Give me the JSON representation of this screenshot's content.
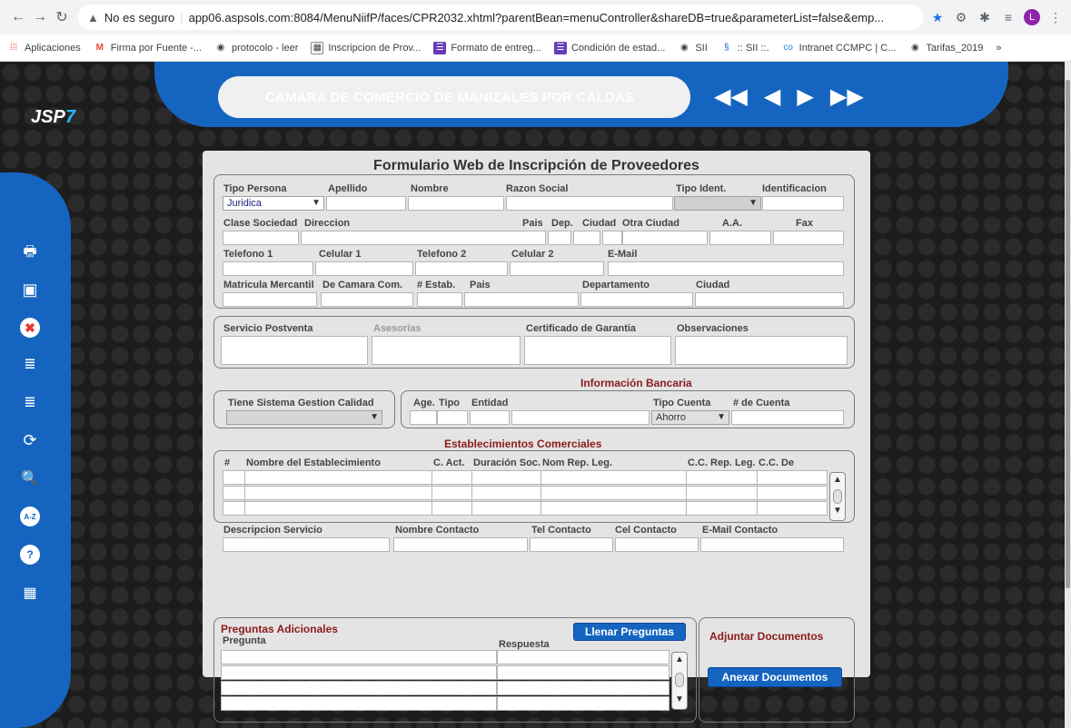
{
  "browser": {
    "security_label": "No es seguro",
    "url": "app06.aspsols.com:8084/MenuNiifP/faces/CPR2032.xhtml?parentBean=menuController&shareDB=true&parameterList=false&emp...",
    "profile_initial": "L",
    "bookmarks": [
      "Aplicaciones",
      "Firma por Fuente -...",
      "protocolo - leer",
      "Inscripcion de Prov...",
      "Formato de entreg...",
      "Condición de estad...",
      "SII",
      ":: SII ::.",
      "Intranet CCMPC | C...",
      "Tarifas_2019"
    ],
    "more": "»"
  },
  "app": {
    "company": "CAMARA DE COMERCIO DE MANIZALES POR CALDAS",
    "logo_main": "JSP",
    "logo_accent": "7",
    "pager": [
      "◀◀",
      "◀",
      "▶",
      "▶▶"
    ],
    "colors": {
      "primary": "#1565c0",
      "section_title": "#8b1a1a",
      "background": "#1c1c1c"
    }
  },
  "sidebar": {
    "icons": [
      "print-icon",
      "save-icon",
      "cancel-icon",
      "add-database-icon",
      "remove-database-icon",
      "refresh-icon",
      "search-document-icon",
      "sort-az-icon",
      "help-icon",
      "excel-icon"
    ],
    "sort_label": "A-Z"
  },
  "form": {
    "title": "Formulario Web de Inscripción de Proveedores",
    "general": {
      "tipo_persona": "Tipo Persona",
      "tipo_persona_value": "Juridica",
      "apellido": "Apellido",
      "nombre": "Nombre",
      "razon_social": "Razon Social",
      "tipo_ident": "Tipo Ident.",
      "identificacion": "Identificacion",
      "clase_sociedad": "Clase Sociedad",
      "direccion": "Direccion",
      "pais": "Pais",
      "dep": "Dep.",
      "ciudad": "Ciudad",
      "otra_ciudad": "Otra Ciudad",
      "aa": "A.A.",
      "fax": "Fax",
      "telefono1": "Telefono 1",
      "celular1": "Celular 1",
      "telefono2": "Telefono 2",
      "celular2": "Celular 2",
      "email": "E-Mail",
      "matricula": "Matricula Mercantil",
      "de_camara": "De Camara Com.",
      "num_estab": "# Estab.",
      "pais2": "Pais",
      "departamento": "Departamento",
      "ciudad2": "Ciudad"
    },
    "service": {
      "postventa": "Servicio Postventa",
      "asesorias": "Asesorias",
      "certificado": "Certificado de Garantia",
      "observaciones": "Observaciones"
    },
    "quality": {
      "label": "Tiene Sistema Gestion Calidad"
    },
    "bank": {
      "title": "Información Bancaria",
      "age": "Age.",
      "tipo": "Tipo",
      "entidad": "Entidad",
      "tipo_cuenta": "Tipo Cuenta",
      "tipo_cuenta_value": "Ahorro",
      "num_cuenta": "# de Cuenta"
    },
    "establishments": {
      "title": "Establecimientos Comerciales",
      "columns": [
        "#",
        "Nombre del Establecimiento",
        "C. Act.",
        "Duración Soc.",
        "Nom Rep. Leg.",
        "C.C. Rep. Leg.",
        "C.C. De"
      ],
      "descripcion": "Descripcion Servicio",
      "nombre_contacto": "Nombre Contacto",
      "tel_contacto": "Tel Contacto",
      "cel_contacto": "Cel Contacto",
      "email_contacto": "E-Mail Contacto"
    },
    "questions": {
      "title": "Preguntas Adicionales",
      "fill_button": "Llenar Preguntas",
      "pregunta": "Pregunta",
      "respuesta": "Respuesta"
    },
    "documents": {
      "title": "Adjuntar Documentos",
      "attach_button": "Anexar Documentos"
    }
  }
}
